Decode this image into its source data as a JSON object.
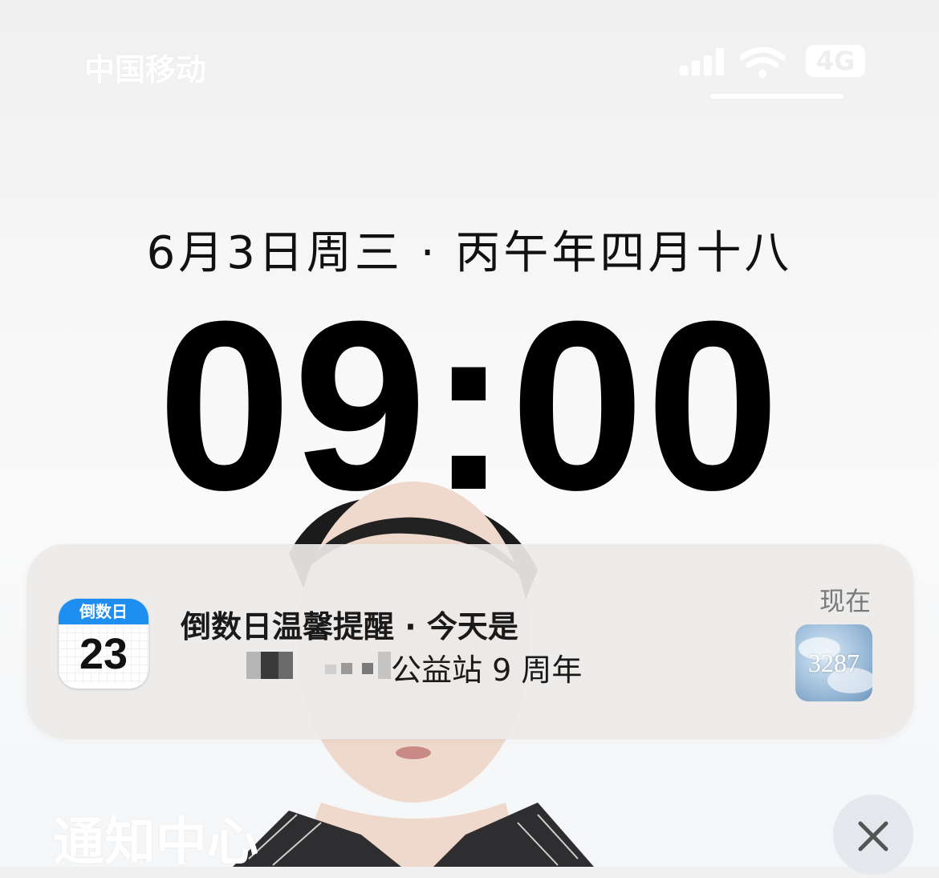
{
  "status_bar": {
    "carrier": "中国移动",
    "network": "4G",
    "signal_bars": 4,
    "icons": [
      "signal-icon",
      "wifi-icon",
      "battery-icon"
    ]
  },
  "lock_screen": {
    "date": "6月3日周三 · 丙午年四月十八",
    "time": "09:00"
  },
  "notification": {
    "app_icon": {
      "name": "countdown-calendar-icon",
      "header": "倒数日",
      "day": "23",
      "accent": "#1e8ef0"
    },
    "title": "倒数日温馨提醒 · 今天是",
    "body_visible": "公益站 9 周年",
    "time": "现在",
    "thumbnail_text": "3287"
  },
  "footer": {
    "notification_center_label": "通知中心",
    "close_icon": "close-icon"
  }
}
